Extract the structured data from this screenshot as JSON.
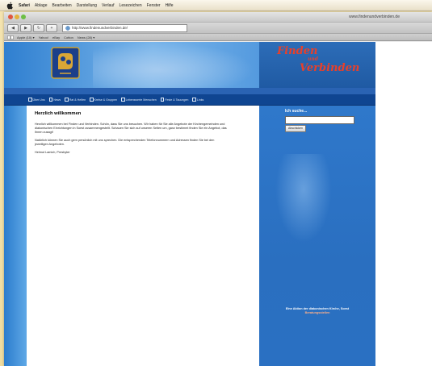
{
  "menubar": {
    "items": [
      {
        "label": "Safari",
        "app": true
      },
      {
        "label": "Ablage"
      },
      {
        "label": "Bearbeiten"
      },
      {
        "label": "Darstellung"
      },
      {
        "label": "Verlauf"
      },
      {
        "label": "Lesezeichen"
      },
      {
        "label": "Fenster"
      },
      {
        "label": "Hilfe"
      }
    ]
  },
  "window": {
    "title": "www.findenundverbinden.de",
    "url": "http://www.findenundverbinden.de/",
    "back_label": "◀",
    "forward_label": "▶",
    "reload_label": "↻",
    "add_label": "+",
    "bookmarks": [
      "Apple (10) ▾",
      "Yahoo!",
      "eBay",
      "Cotton",
      "News (28) ▾"
    ]
  },
  "page": {
    "brand": {
      "line1": "Finden",
      "line2": "und",
      "line3": "Verbinden"
    },
    "nav": [
      "Über Uns",
      "News",
      "Rat & Helfen",
      "Kreise & Gruppen",
      "Lebenswerte Menschen",
      "Feste & Tauungen",
      "Links"
    ],
    "content": {
      "heading": "Herzlich willkommen",
      "paragraphs": [
        "Herzlich willkommen bei Finden und Verbinden. Schön, dass Sie uns besuchen. Wir haben für Sie alle Angebote der Kirchengemeinden und diakonischen Einrichtungen in Soest zusammengestellt. Schauen Sie sich auf unseren Seiten um, ganz bestimmt finden Sie ein Angebot, das Ihnen zusagt!",
        "Natürlich können Sie auch gern persönlich mit uns sprechen. Die entsprechenden Telefonnummern und Adressen finden Sie bei den jeweiligen Angeboten.",
        "Helmut Lamich, Presbyter"
      ]
    },
    "sidebar": {
      "search_label": "Ich suche...",
      "search_value": "",
      "search_button": "Abschicken",
      "note": "Eine Aktion der diakonischen Kirche, Soest",
      "note_link": "Beratungsstellen"
    }
  }
}
